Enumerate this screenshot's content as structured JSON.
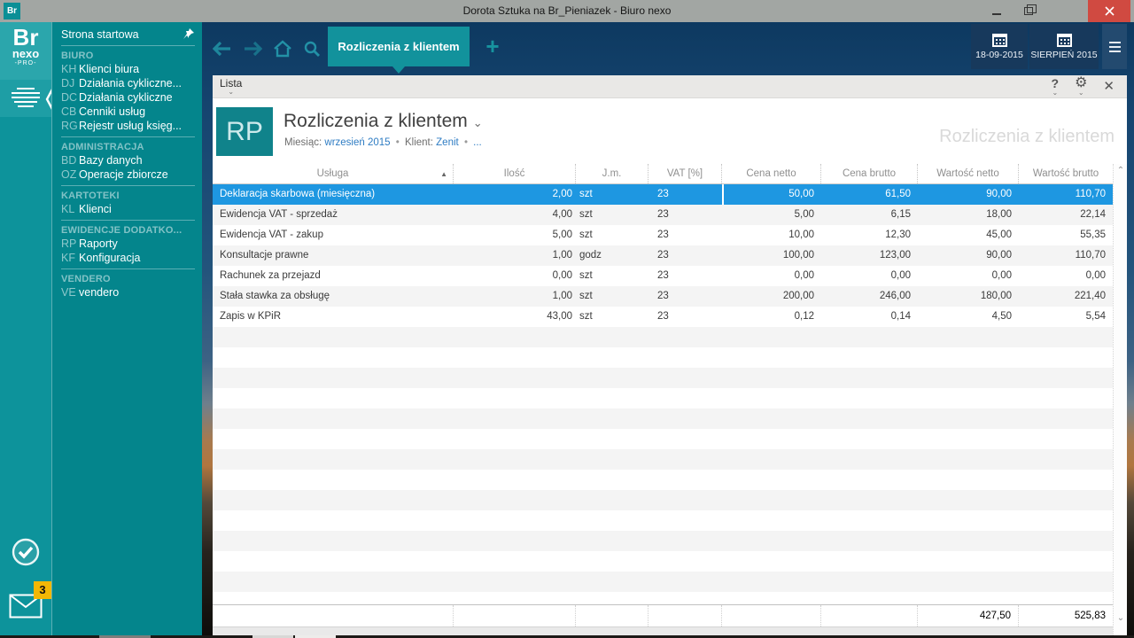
{
  "window": {
    "app_icon": "Br",
    "title": "Dorota Sztuka na Br_Pieniazek - Biuro nexo"
  },
  "sidebar": {
    "logo": {
      "line1": "Br",
      "line2": "nexo",
      "line3": "-PRO-"
    },
    "home_item": "Strona startowa",
    "sections": [
      {
        "header": "BIURO",
        "items": [
          {
            "code": "KH",
            "label": "Klienci biura"
          },
          {
            "code": "DJ",
            "label": "Działania cykliczne..."
          },
          {
            "code": "DC",
            "label": "Działania cykliczne"
          },
          {
            "code": "CB",
            "label": "Cenniki usług"
          },
          {
            "code": "RG",
            "label": "Rejestr usług księg..."
          }
        ]
      },
      {
        "header": "ADMINISTRACJA",
        "items": [
          {
            "code": "BD",
            "label": "Bazy danych"
          },
          {
            "code": "OZ",
            "label": "Operacje zbiorcze"
          }
        ]
      },
      {
        "header": "KARTOTEKI",
        "items": [
          {
            "code": "KL",
            "label": "Klienci"
          }
        ]
      },
      {
        "header": "EWIDENCJE DODATKO...",
        "items": [
          {
            "code": "RP",
            "label": "Raporty"
          },
          {
            "code": "KF",
            "label": "Konfiguracja"
          }
        ]
      },
      {
        "header": "VENDERO",
        "items": [
          {
            "code": "VE",
            "label": "vendero"
          }
        ]
      }
    ],
    "mail_badge": "3"
  },
  "toolbar": {
    "active_tab": "Rozliczenia z klientem",
    "date_button": "18-09-2015",
    "month_button": "SIERPIEŃ 2015"
  },
  "panel": {
    "menu_label": "Lista",
    "badge": "RP",
    "title": "Rozliczenia z klientem",
    "subtitle": {
      "month_label": "Miesiąc:",
      "month_value": "wrzesień 2015",
      "client_label": "Klient:",
      "client_value": "Zenit",
      "more": "..."
    },
    "watermark": "Rozliczenia z klientem"
  },
  "table": {
    "columns": {
      "service": "Usługa",
      "qty": "Ilość",
      "unit": "J.m.",
      "vat": "VAT [%]",
      "net_price": "Cena netto",
      "gross_price": "Cena brutto",
      "net_value": "Wartość netto",
      "gross_value": "Wartość brutto"
    },
    "selected_row_index": 0,
    "rows": [
      {
        "service": "Deklaracja skarbowa (miesięczna)",
        "qty": "2,00",
        "unit": "szt",
        "vat": "23",
        "net_price": "50,00",
        "gross_price": "61,50",
        "net_value": "90,00",
        "gross_value": "110,70"
      },
      {
        "service": "Ewidencja VAT - sprzedaż",
        "qty": "4,00",
        "unit": "szt",
        "vat": "23",
        "net_price": "5,00",
        "gross_price": "6,15",
        "net_value": "18,00",
        "gross_value": "22,14"
      },
      {
        "service": "Ewidencja VAT - zakup",
        "qty": "5,00",
        "unit": "szt",
        "vat": "23",
        "net_price": "10,00",
        "gross_price": "12,30",
        "net_value": "45,00",
        "gross_value": "55,35"
      },
      {
        "service": "Konsultacje prawne",
        "qty": "1,00",
        "unit": "godz",
        "vat": "23",
        "net_price": "100,00",
        "gross_price": "123,00",
        "net_value": "90,00",
        "gross_value": "110,70"
      },
      {
        "service": "Rachunek za przejazd",
        "qty": "0,00",
        "unit": "szt",
        "vat": "23",
        "net_price": "0,00",
        "gross_price": "0,00",
        "net_value": "0,00",
        "gross_value": "0,00"
      },
      {
        "service": "Stała stawka za obsługę",
        "qty": "1,00",
        "unit": "szt",
        "vat": "23",
        "net_price": "200,00",
        "gross_price": "246,00",
        "net_value": "180,00",
        "gross_value": "221,40"
      },
      {
        "service": "Zapis w KPiR",
        "qty": "43,00",
        "unit": "szt",
        "vat": "23",
        "net_price": "0,12",
        "gross_price": "0,14",
        "net_value": "4,50",
        "gross_value": "5,54"
      }
    ],
    "summary": {
      "net_value_total": "427,50",
      "gross_value_total": "525,83"
    }
  },
  "colors": {
    "accent_teal": "#12929c",
    "sidebar_teal": "#04858c",
    "selection_blue": "#1e97e1",
    "link_blue": "#2e7cc3",
    "badge_yellow": "#f2b705",
    "close_red": "#d04a41",
    "navy_button": "#17395c"
  }
}
